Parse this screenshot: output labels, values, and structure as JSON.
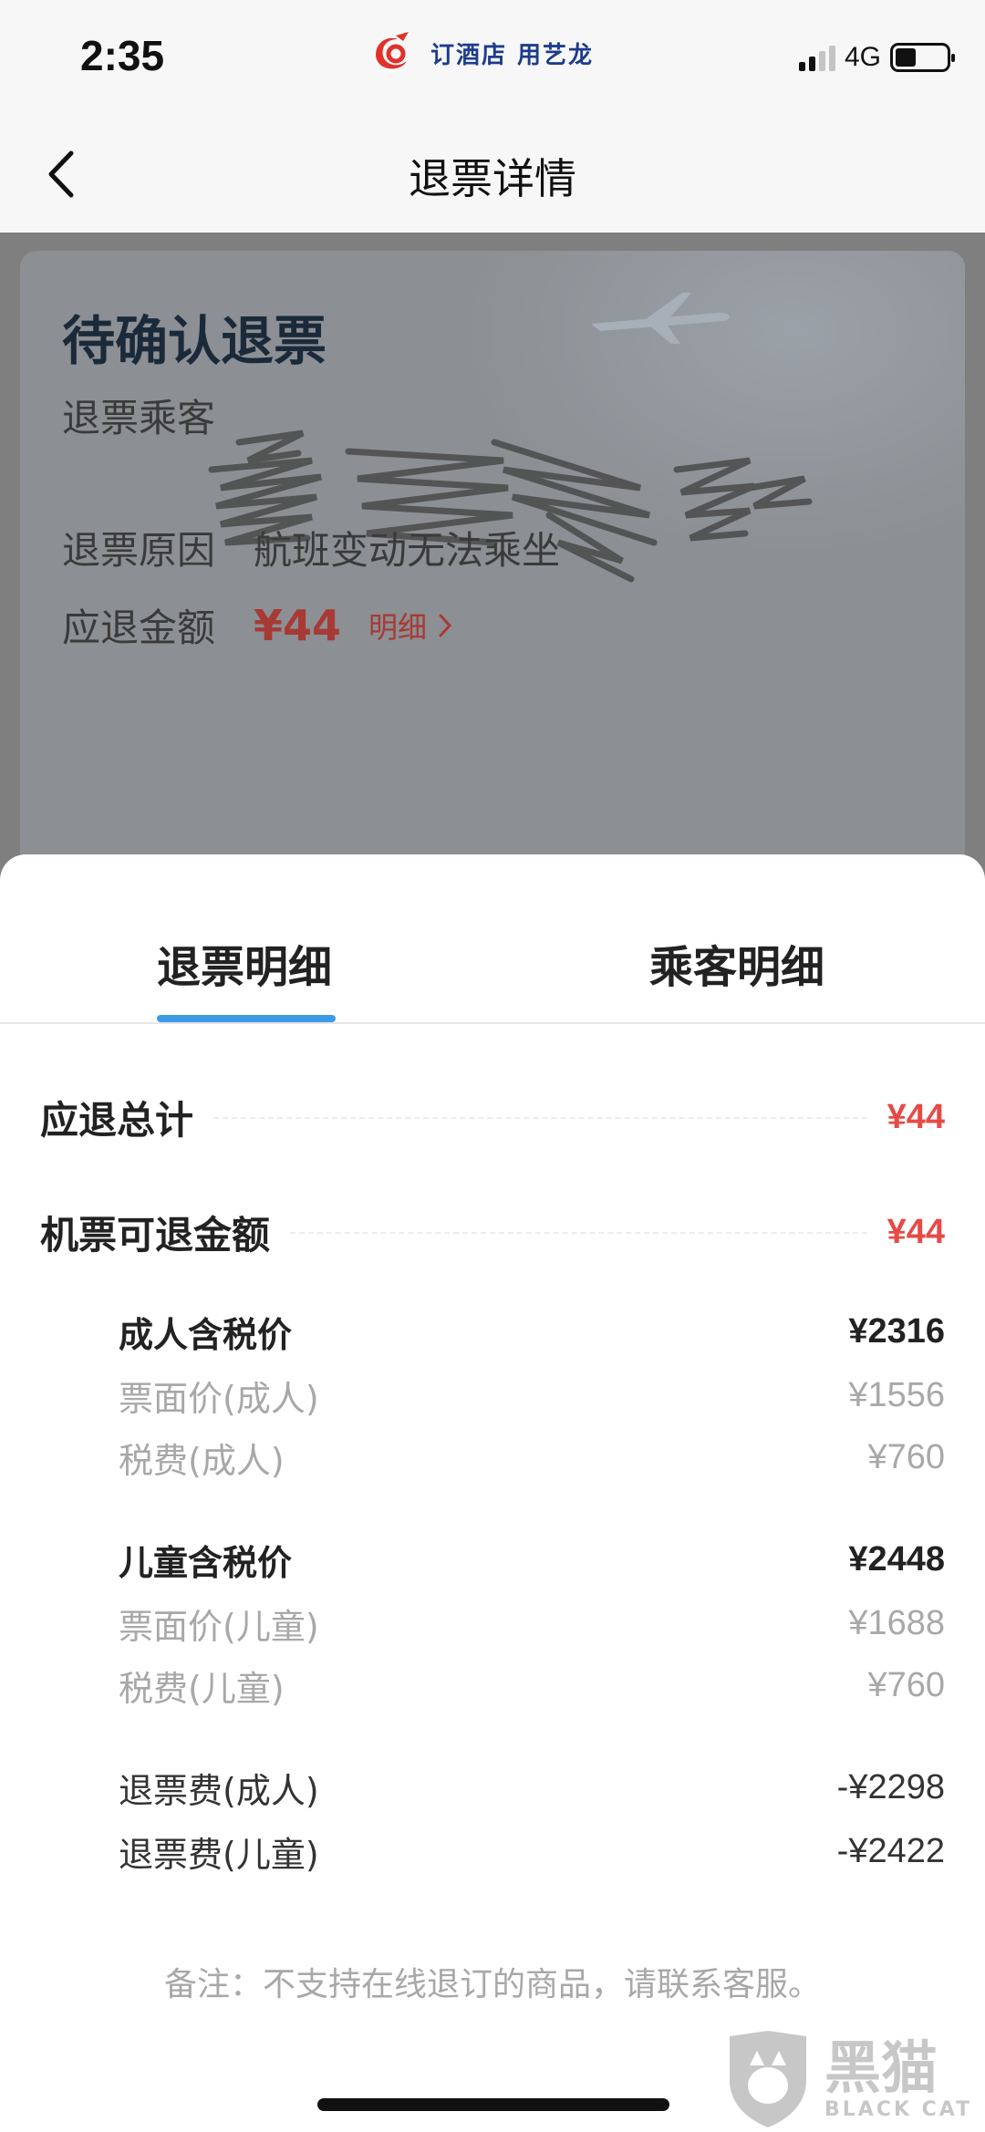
{
  "status_bar": {
    "time": "2:35",
    "ad_text": "订酒店 用艺龙",
    "network": "4G",
    "battery_level": 0.4
  },
  "nav": {
    "title": "退票详情",
    "back_icon": "chevron-left-icon"
  },
  "order": {
    "status": "待确认退票",
    "passenger_label": "退票乘客",
    "reason_label": "退票原因",
    "reason_value": "航班变动无法乘坐",
    "amount_label": "应退金额",
    "amount_value": "¥44",
    "detail_link": "明细"
  },
  "sheet": {
    "tabs": [
      {
        "label": "退票明细",
        "active": true
      },
      {
        "label": "乘客明细",
        "active": false
      }
    ],
    "totals": [
      {
        "label": "应退总计",
        "value": "¥44"
      },
      {
        "label": "机票可退金额",
        "value": "¥44"
      }
    ],
    "adult": {
      "head_label": "成人含税价",
      "head_value": "¥2316",
      "fare_label": "票面价(成人)",
      "fare_value": "¥1556",
      "tax_label": "税费(成人)",
      "tax_value": "¥760"
    },
    "child": {
      "head_label": "儿童含税价",
      "head_value": "¥2448",
      "fare_label": "票面价(儿童)",
      "fare_value": "¥1688",
      "tax_label": "税费(儿童)",
      "tax_value": "¥760"
    },
    "fees": [
      {
        "label": "退票费(成人)",
        "value": "-¥2298"
      },
      {
        "label": "退票费(儿童)",
        "value": "-¥2422"
      }
    ],
    "note": "备注：不支持在线退订的商品，请联系客服。"
  },
  "watermark": {
    "cn": "黑猫",
    "en": "BLACK CAT"
  },
  "colors": {
    "accent_blue": "#3d9ae8",
    "price_red": "#e64a45"
  }
}
